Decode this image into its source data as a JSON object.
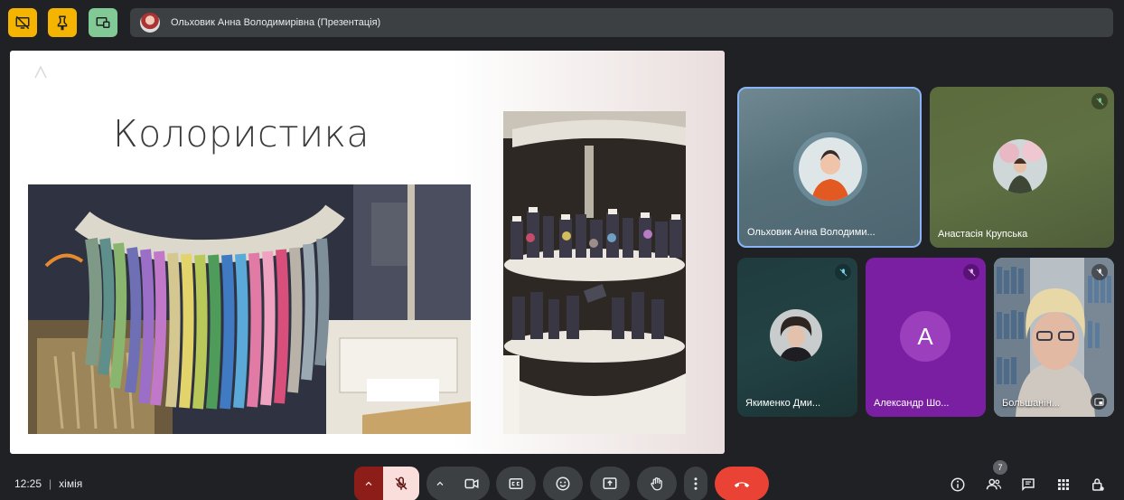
{
  "top_bar": {
    "presenter_label": "Ольховик Анна Володимирівна (Презентація)"
  },
  "slide": {
    "title": "Колористика"
  },
  "participants": [
    {
      "name": "Ольховик Анна Володими..."
    },
    {
      "name": "Анастасія Крупська"
    },
    {
      "name": "Якименко Дми..."
    },
    {
      "name": "Александр Шо...",
      "initial": "A"
    },
    {
      "name": "Большанін..."
    }
  ],
  "bottom_bar": {
    "time": "12:25",
    "separator": "|",
    "meeting_name": "хімія",
    "people_count": "7"
  },
  "colors": {
    "background": "#202124",
    "accent_yellow": "#f4b400",
    "accent_green": "#81c995",
    "end_call": "#ea4335",
    "mic_off_bg": "#f9dedc",
    "active_speaker_border": "#8ab4f8",
    "purple_tile": "#7b1fa2"
  }
}
